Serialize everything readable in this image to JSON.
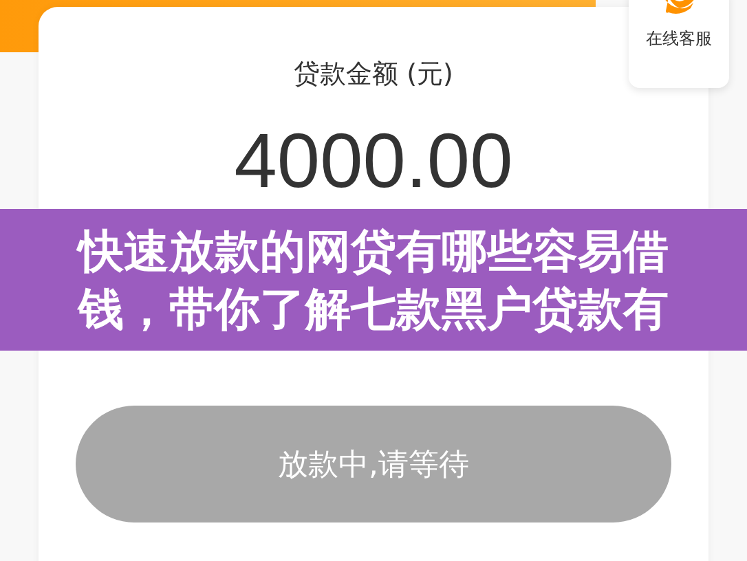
{
  "loan_amount": {
    "label": "贷款金额 (元)",
    "value": "4000.00"
  },
  "service_button": {
    "label": "在线客服"
  },
  "submit_button": {
    "label": "放款中,请等待",
    "disabled": true
  },
  "banner": {
    "title": "快速放款的网贷有哪些容易借钱，带你了解七款黑户贷款有"
  }
}
